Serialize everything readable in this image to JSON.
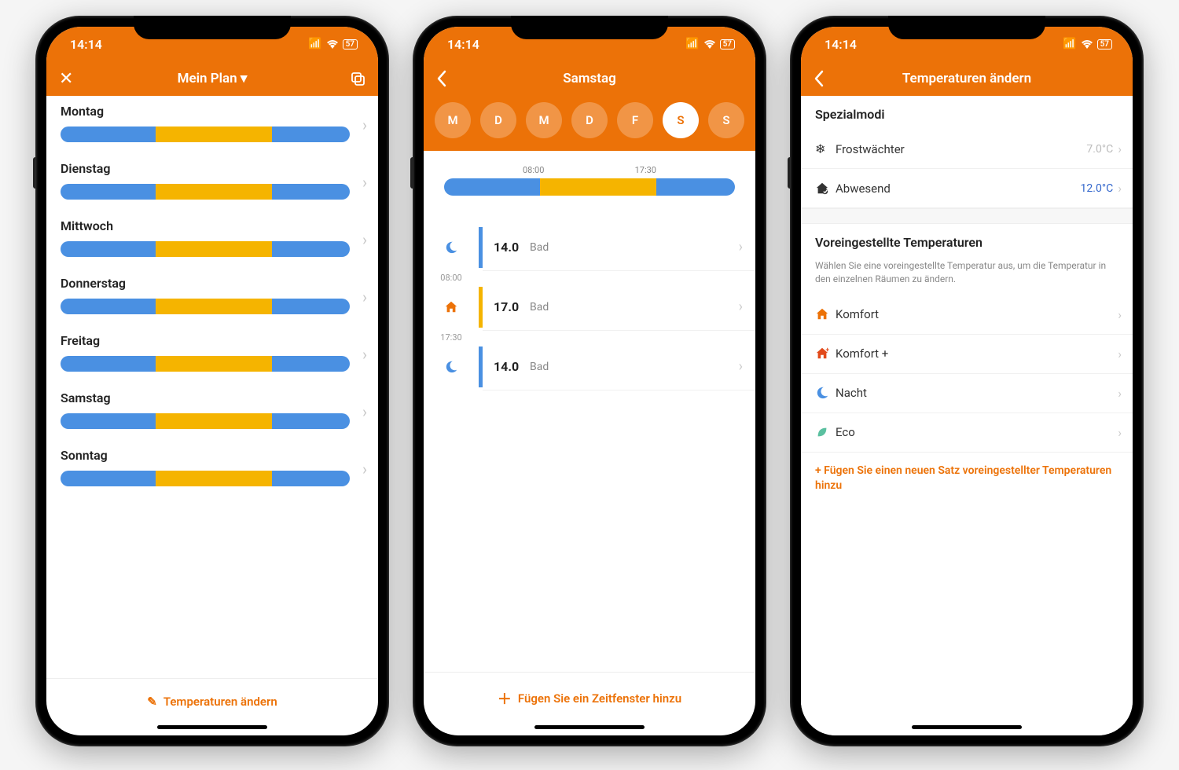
{
  "status": {
    "time": "14:14",
    "battery": "57"
  },
  "screen1": {
    "title": "Mein Plan ▾",
    "days": [
      "Montag",
      "Dienstag",
      "Mittwoch",
      "Donnerstag",
      "Freitag",
      "Samstag",
      "Sonntag"
    ],
    "seg": {
      "start_pct": 33,
      "end_pct": 73
    },
    "footer_action": "Temperaturen ändern"
  },
  "screen2": {
    "title": "Samstag",
    "tabs": [
      "M",
      "D",
      "M",
      "D",
      "F",
      "S",
      "S"
    ],
    "active_tab": 5,
    "bar_labels": {
      "start": "08:00",
      "end": "17:30"
    },
    "seg": {
      "start_pct": 33,
      "end_pct": 73
    },
    "periods": [
      {
        "icon": "moon",
        "color": "blue",
        "temp": "14.0",
        "room": "Bad",
        "time_after": "08:00"
      },
      {
        "icon": "home",
        "color": "orange",
        "temp": "17.0",
        "room": "Bad",
        "time_after": "17:30"
      },
      {
        "icon": "moon",
        "color": "blue",
        "temp": "14.0",
        "room": "Bad",
        "time_after": null
      }
    ],
    "footer_action": "Fügen Sie ein Zeitfenster hinzu"
  },
  "screen3": {
    "title": "Temperaturen ändern",
    "special_title": "Spezialmodi",
    "special": [
      {
        "icon": "❄",
        "label": "Frostwächter",
        "value": "7.0°C",
        "gray": true
      },
      {
        "icon": "away",
        "label": "Abwesend",
        "value": "12.0°C",
        "gray": false
      }
    ],
    "presets_title": "Voreingestellte Temperaturen",
    "presets_desc": "Wählen Sie eine voreingestellte Temperatur aus, um die Temperatur in den einzelnen Räumen zu ändern.",
    "presets": [
      {
        "icon": "home",
        "color": "#ec7208",
        "label": "Komfort"
      },
      {
        "icon": "home-plus",
        "color": "#e24a1a",
        "label": "Komfort +"
      },
      {
        "icon": "moon",
        "color": "#4a90e2",
        "label": "Nacht"
      },
      {
        "icon": "leaf",
        "color": "#5bc0a0",
        "label": "Eco"
      }
    ],
    "add_preset": "+ Fügen Sie einen neuen Satz voreingestellter Temperaturen hinzu"
  }
}
